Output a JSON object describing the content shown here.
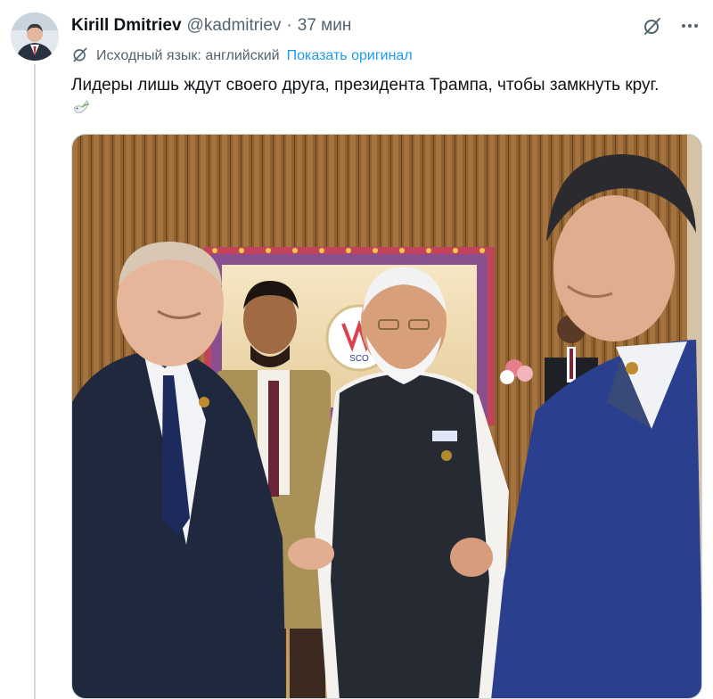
{
  "tweet": {
    "display_name": "Kirill Dmitriev",
    "handle": "@kadmitriev",
    "separator": "·",
    "time": "37 мин",
    "translation_note": "Исходный язык: английский",
    "show_original": "Показать оригинал",
    "text": "Лидеры лишь ждут своего друга, президента Трампа, чтобы замкнуть круг.",
    "emoji": "dove-icon"
  },
  "icons": {
    "grok": "grok-icon",
    "more": "more-icon",
    "translate": "translate-icon"
  },
  "media": {
    "kind": "photo",
    "badge_text": "SCO"
  },
  "colors": {
    "link": "#1d9bf0",
    "secondary_text": "#536471",
    "primary_text": "#0f1419",
    "thread_line": "#cfd9de"
  }
}
